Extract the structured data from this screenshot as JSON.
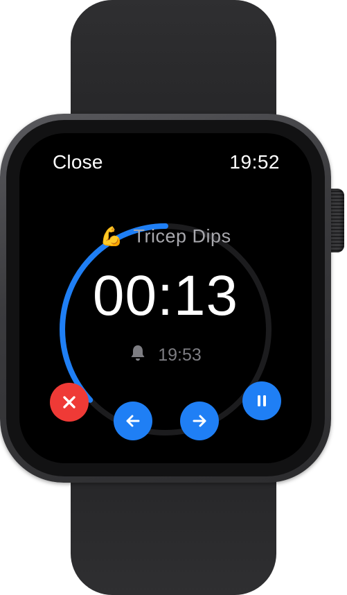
{
  "screen": {
    "status": {
      "close_label": "Close",
      "time": "19:52"
    },
    "exercise": {
      "emoji": "💪",
      "name": "Tricep Dips"
    },
    "timer": {
      "remaining": "00:13",
      "progress_fraction": 0.37
    },
    "alarm": {
      "icon": "bell-icon",
      "time": "19:53"
    },
    "controls": {
      "cancel_icon": "x-icon",
      "previous_icon": "arrow-left-icon",
      "next_icon": "arrow-right-icon",
      "pause_icon": "pause-icon"
    }
  },
  "colors": {
    "accent": "#1f7ff5",
    "destructive": "#ef3a36",
    "ring_track": "#1c1c1e",
    "secondary_text": "#a8a8ad"
  }
}
